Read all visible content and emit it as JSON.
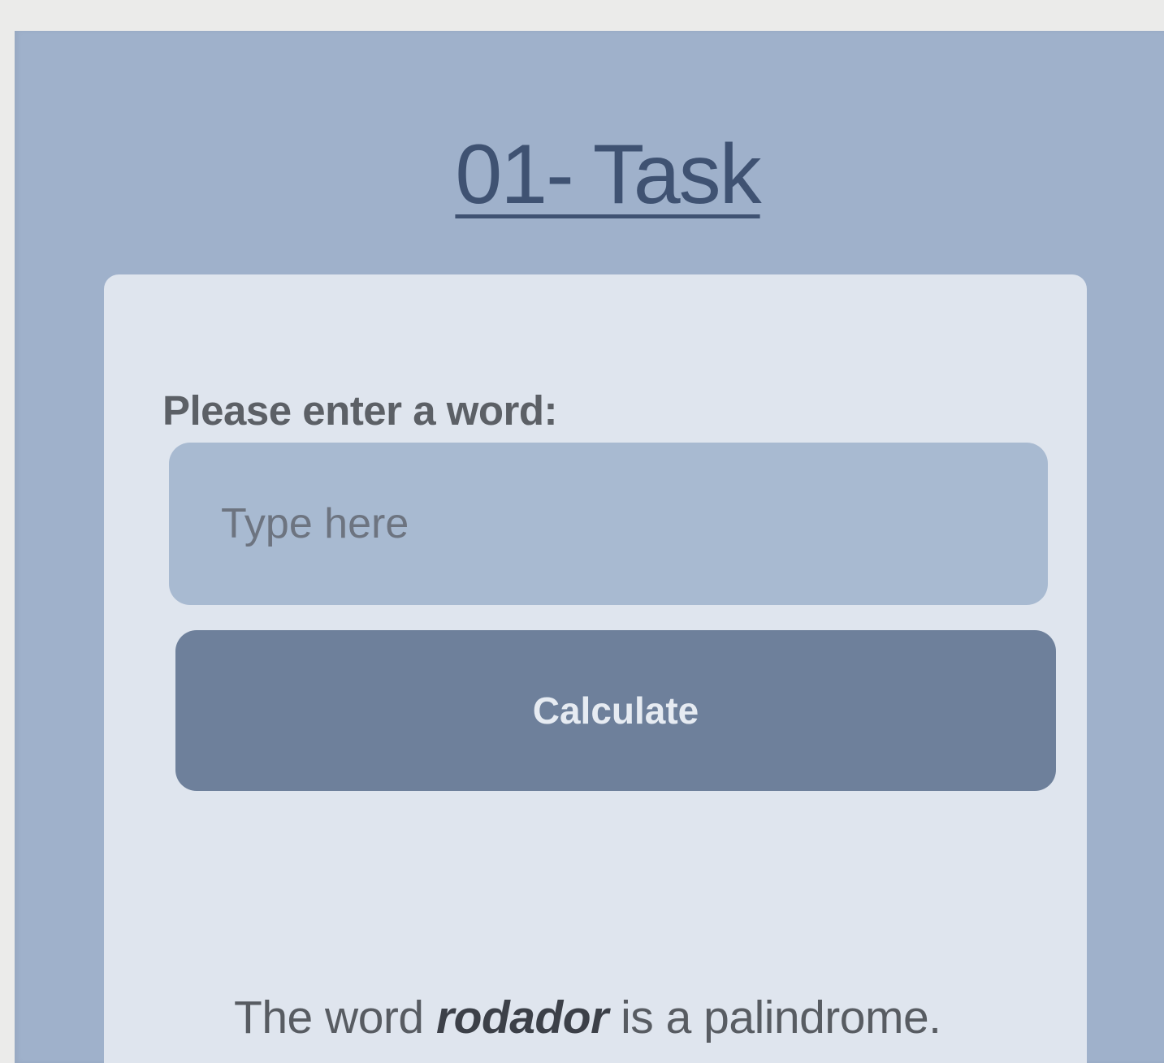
{
  "header": {
    "title": "01- Task"
  },
  "form": {
    "label": "Please enter a word:",
    "input_value": "",
    "input_placeholder": "Type here",
    "button_label": "Calculate"
  },
  "result": {
    "prefix": "The word ",
    "word": "rodador",
    "suffix": " is a palindrome."
  },
  "colors": {
    "panel_background": "#9fb1cb",
    "card_background": "#dfe5ee",
    "input_background": "#a8bad1",
    "button_background": "#6e809b",
    "title_color": "#3f5272"
  }
}
